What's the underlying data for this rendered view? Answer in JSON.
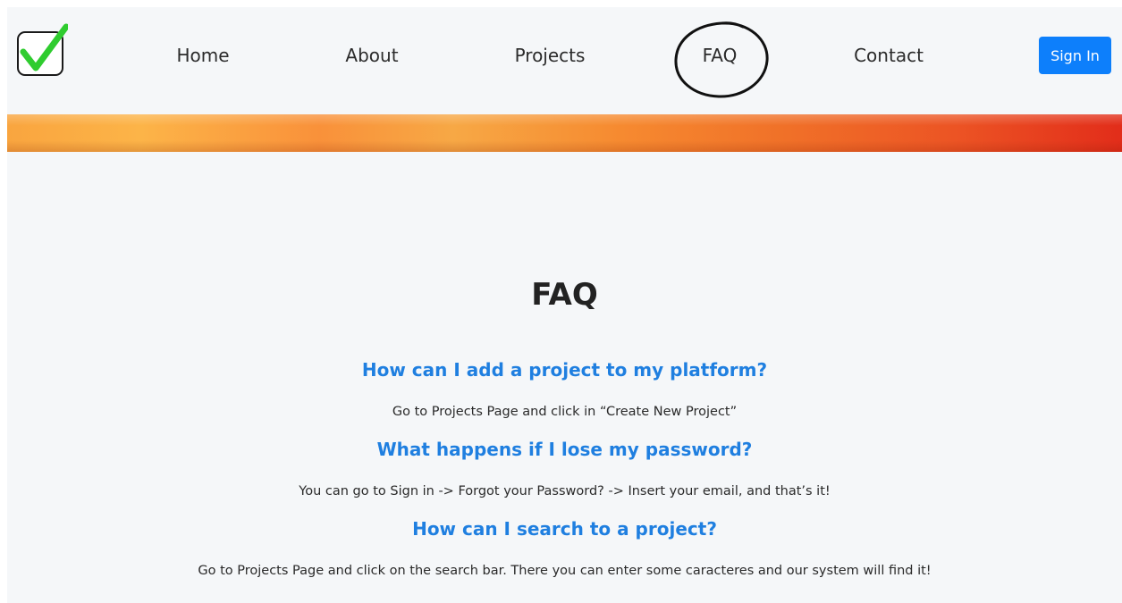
{
  "colors": {
    "accent": "#0d7ffb",
    "question": "#1f7fe0",
    "check": "#2fcc2f"
  },
  "nav": {
    "logo_icon": "checkbox-check-icon",
    "items": [
      {
        "label": "Home"
      },
      {
        "label": "About"
      },
      {
        "label": "Projects"
      },
      {
        "label": "FAQ"
      },
      {
        "label": "Contact"
      }
    ],
    "signin_label": "Sign In"
  },
  "main": {
    "title": "FAQ",
    "faqs": [
      {
        "question": "How can I add a project to my platform?",
        "answer": "Go to Projects Page and click in “Create New Project”"
      },
      {
        "question": "What happens if I lose my password?",
        "answer": "You can go to Sign in -> Forgot your Password? -> Insert your email, and that’s it!"
      },
      {
        "question": "How can I search to a project?",
        "answer": "Go to Projects Page and click on the search bar. There you can enter some caracteres and our system will find it!"
      }
    ]
  }
}
